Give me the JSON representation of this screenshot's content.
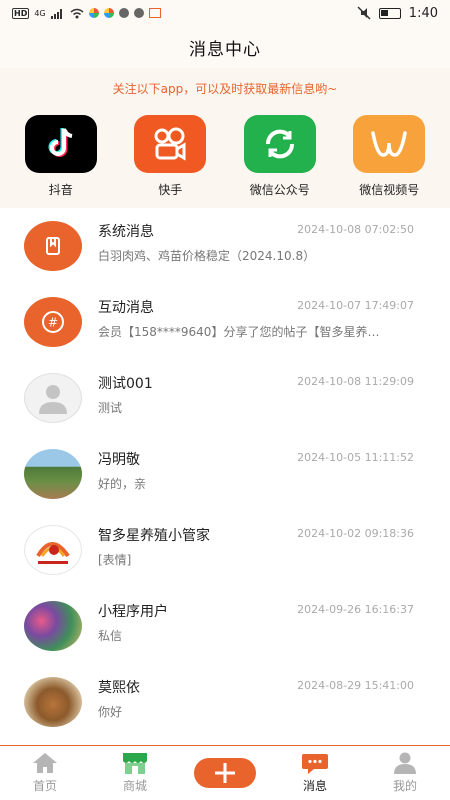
{
  "status_bar": {
    "time": "1:40",
    "network_label": "HD",
    "signal_label": "4G"
  },
  "header": {
    "title": "消息中心"
  },
  "promo": {
    "tip": "关注以下app，可以及时获取最新信息哟~",
    "apps": [
      {
        "label": "抖音",
        "icon": "douyin-icon",
        "color": "#000000"
      },
      {
        "label": "快手",
        "icon": "kuaishou-icon",
        "color": "#f05a22"
      },
      {
        "label": "微信公众号",
        "icon": "wechat-official-icon",
        "color": "#22b14c"
      },
      {
        "label": "微信视频号",
        "icon": "wechat-channels-icon",
        "color": "#f7a23b"
      }
    ]
  },
  "messages": [
    {
      "name": "系统消息",
      "time": "2024-10-08 07:02:50",
      "preview": "白羽肉鸡、鸡苗价格稳定（2024.10.8）",
      "avatar": "system-message-icon"
    },
    {
      "name": "互动消息",
      "time": "2024-10-07 17:49:07",
      "preview": "会员【158****9640】分享了您的帖子【智多星养…",
      "avatar": "interaction-message-icon"
    },
    {
      "name": "测试001",
      "time": "2024-10-08 11:29:09",
      "preview": "测试",
      "avatar": "default-user-avatar"
    },
    {
      "name": "冯明敬",
      "time": "2024-10-05 11:11:52",
      "preview": "好的，亲",
      "avatar": "landscape-avatar"
    },
    {
      "name": "智多星养殖小管家",
      "time": "2024-10-02 09:18:36",
      "preview": "[表情]",
      "avatar": "rooster-logo-avatar"
    },
    {
      "name": "小程序用户",
      "time": "2024-09-26 16:16:37",
      "preview": "私信",
      "avatar": "photo-avatar"
    },
    {
      "name": "莫熙依",
      "time": "2024-08-29 15:41:00",
      "preview": "你好",
      "avatar": "chicken-avatar"
    }
  ],
  "tabbar": {
    "active": "消息",
    "accent_color": "#e8642c",
    "tabs": [
      {
        "label": "首页",
        "icon": "home-icon"
      },
      {
        "label": "商城",
        "icon": "shop-icon"
      },
      {
        "label": "",
        "icon": "plus-icon"
      },
      {
        "label": "消息",
        "icon": "message-icon"
      },
      {
        "label": "我的",
        "icon": "profile-icon"
      }
    ]
  }
}
